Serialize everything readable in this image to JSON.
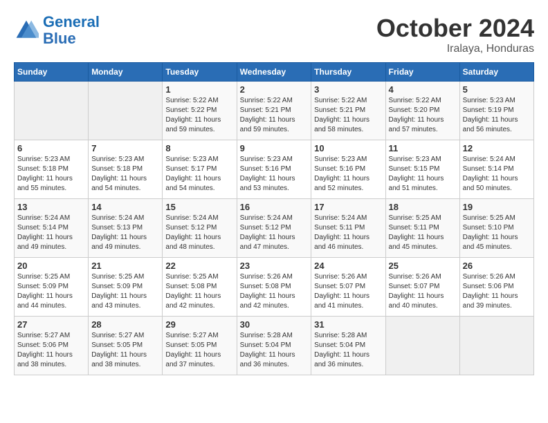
{
  "header": {
    "logo_line1": "General",
    "logo_line2": "Blue",
    "month": "October 2024",
    "location": "Iralaya, Honduras"
  },
  "days_of_week": [
    "Sunday",
    "Monday",
    "Tuesday",
    "Wednesday",
    "Thursday",
    "Friday",
    "Saturday"
  ],
  "weeks": [
    [
      {
        "day": "",
        "sunrise": "",
        "sunset": "",
        "daylight": ""
      },
      {
        "day": "",
        "sunrise": "",
        "sunset": "",
        "daylight": ""
      },
      {
        "day": "1",
        "sunrise": "Sunrise: 5:22 AM",
        "sunset": "Sunset: 5:22 PM",
        "daylight": "Daylight: 11 hours and 59 minutes."
      },
      {
        "day": "2",
        "sunrise": "Sunrise: 5:22 AM",
        "sunset": "Sunset: 5:21 PM",
        "daylight": "Daylight: 11 hours and 59 minutes."
      },
      {
        "day": "3",
        "sunrise": "Sunrise: 5:22 AM",
        "sunset": "Sunset: 5:21 PM",
        "daylight": "Daylight: 11 hours and 58 minutes."
      },
      {
        "day": "4",
        "sunrise": "Sunrise: 5:22 AM",
        "sunset": "Sunset: 5:20 PM",
        "daylight": "Daylight: 11 hours and 57 minutes."
      },
      {
        "day": "5",
        "sunrise": "Sunrise: 5:23 AM",
        "sunset": "Sunset: 5:19 PM",
        "daylight": "Daylight: 11 hours and 56 minutes."
      }
    ],
    [
      {
        "day": "6",
        "sunrise": "Sunrise: 5:23 AM",
        "sunset": "Sunset: 5:18 PM",
        "daylight": "Daylight: 11 hours and 55 minutes."
      },
      {
        "day": "7",
        "sunrise": "Sunrise: 5:23 AM",
        "sunset": "Sunset: 5:18 PM",
        "daylight": "Daylight: 11 hours and 54 minutes."
      },
      {
        "day": "8",
        "sunrise": "Sunrise: 5:23 AM",
        "sunset": "Sunset: 5:17 PM",
        "daylight": "Daylight: 11 hours and 54 minutes."
      },
      {
        "day": "9",
        "sunrise": "Sunrise: 5:23 AM",
        "sunset": "Sunset: 5:16 PM",
        "daylight": "Daylight: 11 hours and 53 minutes."
      },
      {
        "day": "10",
        "sunrise": "Sunrise: 5:23 AM",
        "sunset": "Sunset: 5:16 PM",
        "daylight": "Daylight: 11 hours and 52 minutes."
      },
      {
        "day": "11",
        "sunrise": "Sunrise: 5:23 AM",
        "sunset": "Sunset: 5:15 PM",
        "daylight": "Daylight: 11 hours and 51 minutes."
      },
      {
        "day": "12",
        "sunrise": "Sunrise: 5:24 AM",
        "sunset": "Sunset: 5:14 PM",
        "daylight": "Daylight: 11 hours and 50 minutes."
      }
    ],
    [
      {
        "day": "13",
        "sunrise": "Sunrise: 5:24 AM",
        "sunset": "Sunset: 5:14 PM",
        "daylight": "Daylight: 11 hours and 49 minutes."
      },
      {
        "day": "14",
        "sunrise": "Sunrise: 5:24 AM",
        "sunset": "Sunset: 5:13 PM",
        "daylight": "Daylight: 11 hours and 49 minutes."
      },
      {
        "day": "15",
        "sunrise": "Sunrise: 5:24 AM",
        "sunset": "Sunset: 5:12 PM",
        "daylight": "Daylight: 11 hours and 48 minutes."
      },
      {
        "day": "16",
        "sunrise": "Sunrise: 5:24 AM",
        "sunset": "Sunset: 5:12 PM",
        "daylight": "Daylight: 11 hours and 47 minutes."
      },
      {
        "day": "17",
        "sunrise": "Sunrise: 5:24 AM",
        "sunset": "Sunset: 5:11 PM",
        "daylight": "Daylight: 11 hours and 46 minutes."
      },
      {
        "day": "18",
        "sunrise": "Sunrise: 5:25 AM",
        "sunset": "Sunset: 5:11 PM",
        "daylight": "Daylight: 11 hours and 45 minutes."
      },
      {
        "day": "19",
        "sunrise": "Sunrise: 5:25 AM",
        "sunset": "Sunset: 5:10 PM",
        "daylight": "Daylight: 11 hours and 45 minutes."
      }
    ],
    [
      {
        "day": "20",
        "sunrise": "Sunrise: 5:25 AM",
        "sunset": "Sunset: 5:09 PM",
        "daylight": "Daylight: 11 hours and 44 minutes."
      },
      {
        "day": "21",
        "sunrise": "Sunrise: 5:25 AM",
        "sunset": "Sunset: 5:09 PM",
        "daylight": "Daylight: 11 hours and 43 minutes."
      },
      {
        "day": "22",
        "sunrise": "Sunrise: 5:25 AM",
        "sunset": "Sunset: 5:08 PM",
        "daylight": "Daylight: 11 hours and 42 minutes."
      },
      {
        "day": "23",
        "sunrise": "Sunrise: 5:26 AM",
        "sunset": "Sunset: 5:08 PM",
        "daylight": "Daylight: 11 hours and 42 minutes."
      },
      {
        "day": "24",
        "sunrise": "Sunrise: 5:26 AM",
        "sunset": "Sunset: 5:07 PM",
        "daylight": "Daylight: 11 hours and 41 minutes."
      },
      {
        "day": "25",
        "sunrise": "Sunrise: 5:26 AM",
        "sunset": "Sunset: 5:07 PM",
        "daylight": "Daylight: 11 hours and 40 minutes."
      },
      {
        "day": "26",
        "sunrise": "Sunrise: 5:26 AM",
        "sunset": "Sunset: 5:06 PM",
        "daylight": "Daylight: 11 hours and 39 minutes."
      }
    ],
    [
      {
        "day": "27",
        "sunrise": "Sunrise: 5:27 AM",
        "sunset": "Sunset: 5:06 PM",
        "daylight": "Daylight: 11 hours and 38 minutes."
      },
      {
        "day": "28",
        "sunrise": "Sunrise: 5:27 AM",
        "sunset": "Sunset: 5:05 PM",
        "daylight": "Daylight: 11 hours and 38 minutes."
      },
      {
        "day": "29",
        "sunrise": "Sunrise: 5:27 AM",
        "sunset": "Sunset: 5:05 PM",
        "daylight": "Daylight: 11 hours and 37 minutes."
      },
      {
        "day": "30",
        "sunrise": "Sunrise: 5:28 AM",
        "sunset": "Sunset: 5:04 PM",
        "daylight": "Daylight: 11 hours and 36 minutes."
      },
      {
        "day": "31",
        "sunrise": "Sunrise: 5:28 AM",
        "sunset": "Sunset: 5:04 PM",
        "daylight": "Daylight: 11 hours and 36 minutes."
      },
      {
        "day": "",
        "sunrise": "",
        "sunset": "",
        "daylight": ""
      },
      {
        "day": "",
        "sunrise": "",
        "sunset": "",
        "daylight": ""
      }
    ]
  ]
}
